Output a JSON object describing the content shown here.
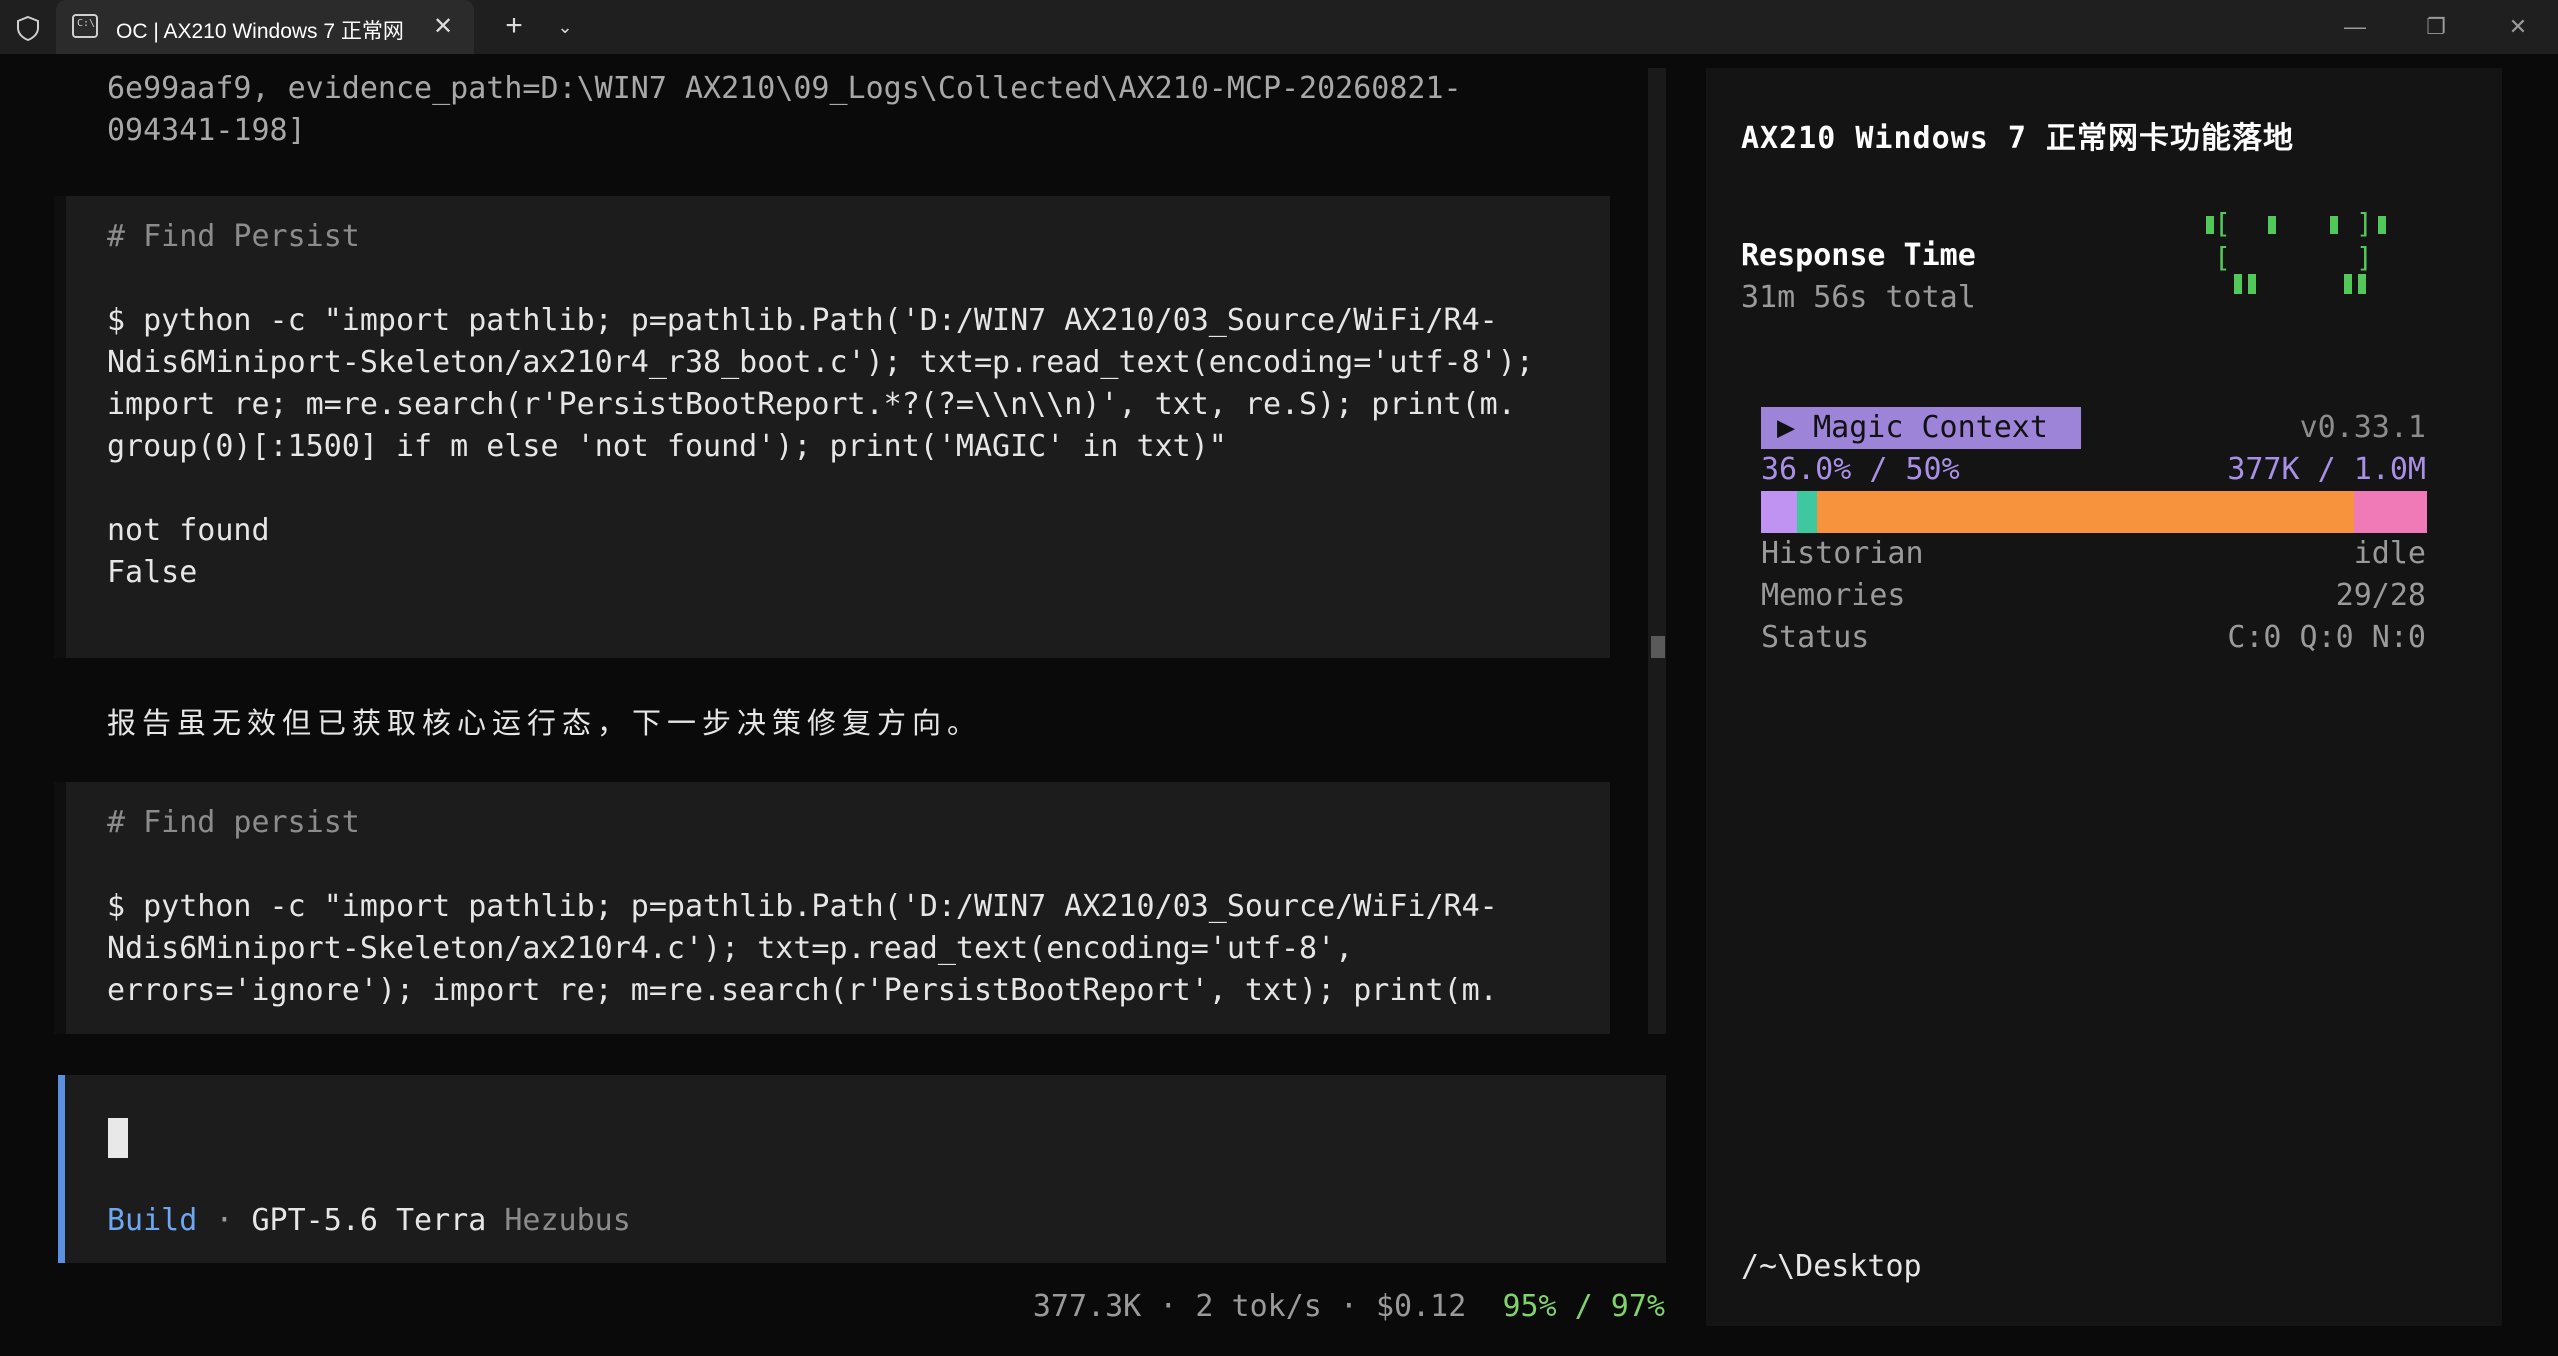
{
  "window": {
    "tab_title": "OC | AX210 Windows 7 正常网",
    "tab_icon_text": "C:\\",
    "close_glyph": "✕",
    "new_tab_glyph": "+",
    "dropdown_glyph": "⌄",
    "min_glyph": "—",
    "max_glyph": "❐",
    "winclose_glyph": "✕"
  },
  "transcript": {
    "evidence_lines": [
      "6e99aaf9, evidence_path=D:\\WIN7 AX210\\09_Logs\\Collected\\AX210-MCP-20260821-",
      "094341-198]"
    ],
    "block1": {
      "comment": "# Find Persist",
      "command_lines": [
        "$ python -c \"import pathlib; p=pathlib.Path('D:/WIN7 AX210/03_Source/WiFi/R4-",
        "Ndis6Miniport-Skeleton/ax210r4_r38_boot.c'); txt=p.read_text(encoding='utf-8');",
        "import re; m=re.search(r'PersistBootReport.*?(?=\\\\n\\\\n)', txt, re.S); print(m.",
        "group(0)[:1500] if m else 'not found'); print('MAGIC' in txt)\""
      ],
      "output_lines": [
        "not found",
        "False"
      ]
    },
    "note": "报告虽无效但已获取核心运行态，下一步决策修复方向。",
    "block2": {
      "comment": "# Find persist",
      "command_lines": [
        "$ python -c \"import pathlib; p=pathlib.Path('D:/WIN7 AX210/03_Source/WiFi/R4-",
        "Ndis6Miniport-Skeleton/ax210r4.c'); txt=p.read_text(encoding='utf-8',",
        "errors='ignore'); import re; m=re.search(r'PersistBootReport', txt); print(m."
      ]
    }
  },
  "input": {
    "mode": "Build",
    "separator": " · ",
    "model": "GPT-5.6 Terra",
    "provider": " Hezubus"
  },
  "status": {
    "stats": "377.3K · 2 tok/s · $0.12  ",
    "percent": "95% / 97%"
  },
  "sidebar": {
    "title": "AX210 Windows 7 正常网卡功能落地",
    "response_label": "Response Time",
    "response_value": "31m 56s total",
    "magic_context": {
      "badge": "▶ Magic Context",
      "version": "v0.33.1",
      "usage_pct": "36.0% / 50%",
      "usage_tokens": "377K / 1.0M",
      "bar_fraction": 0.36
    },
    "historian_label": "Historian",
    "historian_value": "idle",
    "memories_label": "Memories",
    "memories_value": "29/28",
    "status_label": "Status",
    "status_value": "C:0 Q:0 N:0",
    "cwd": "/~\\Desktop"
  },
  "colors": {
    "accent_blue": "#5b8fe0",
    "badge_purple": "#9d84d8",
    "bar_orange": "#f7923d",
    "bar_purple": "#c093f2",
    "bar_teal": "#3fc8a0",
    "bar_pink": "#f07ab8",
    "ok_green": "#7fd36b",
    "spinner_green": "#52c75a"
  }
}
